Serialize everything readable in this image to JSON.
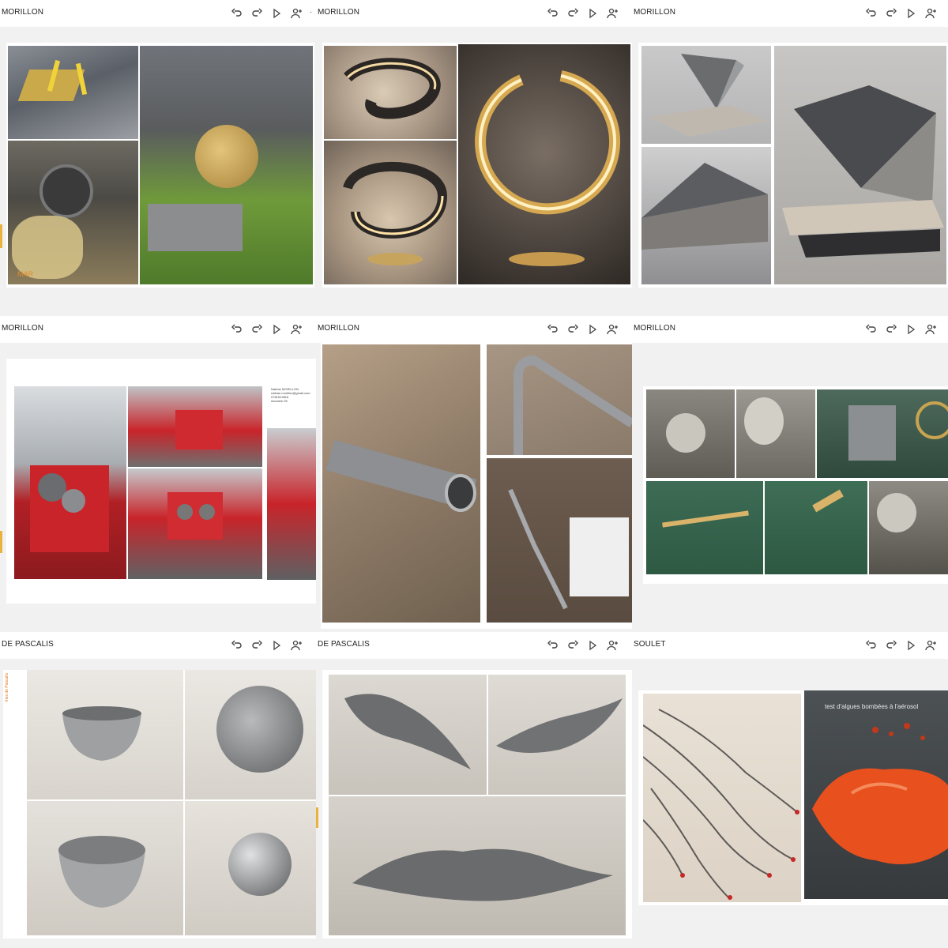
{
  "toolbar_icons": [
    "undo-icon",
    "redo-icon",
    "play-icon",
    "add-person-icon",
    "more-icon"
  ],
  "panels": [
    {
      "name": "MORILLON"
    },
    {
      "name": "MORILLON"
    },
    {
      "name": "MORILLON"
    },
    {
      "name": "MORILLON"
    },
    {
      "name": "MORILLON"
    },
    {
      "name": "MORILLON"
    },
    {
      "name": "DE PASCALIS"
    },
    {
      "name": "DE PASCALIS"
    },
    {
      "name": "SOULET"
    }
  ],
  "slide1": {
    "watermark": "MAR"
  },
  "slide4": {
    "contact": "Nathan MORILLON\nnathan.morillon@gmail.com\n0781613816\nsemaine 05"
  },
  "slide7": {
    "side_text": "Ines de Pascalis"
  },
  "slide9": {
    "caption": "test d'algues bombées à l'aérosol"
  },
  "colors": {
    "accent_orange": "#e8b23c",
    "lathe_green": "#6f9a3a",
    "machine_red": "#c8242a",
    "algae_orange": "#e8501e"
  }
}
